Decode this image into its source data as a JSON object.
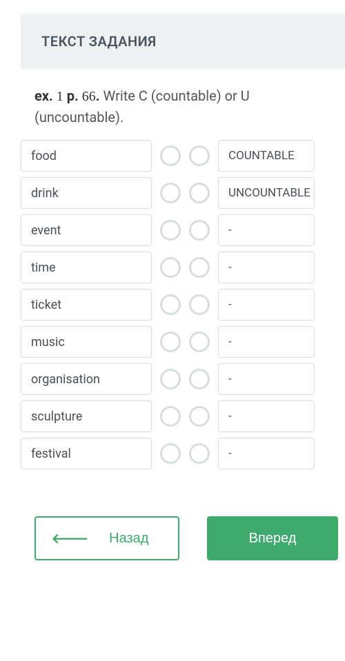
{
  "header": {
    "title": "ТЕКСТ ЗАДАНИЯ"
  },
  "instruction": {
    "ex": "ex.",
    "num1": "1",
    "p": "p.",
    "num2": "66",
    "dot": ".",
    "text": " Write C (countable) or U (uncountable)."
  },
  "rows": [
    {
      "word": "food",
      "answer": "COUNTABLE"
    },
    {
      "word": "drink",
      "answer": "UNCOUNTABLE"
    },
    {
      "word": "event",
      "answer": "-"
    },
    {
      "word": "time",
      "answer": "-"
    },
    {
      "word": "ticket",
      "answer": "-"
    },
    {
      "word": "music",
      "answer": "-"
    },
    {
      "word": "organisation",
      "answer": "-"
    },
    {
      "word": "sculpture",
      "answer": "-"
    },
    {
      "word": "festival",
      "answer": "-"
    }
  ],
  "nav": {
    "back": "Назад",
    "forward": "Вперед"
  }
}
